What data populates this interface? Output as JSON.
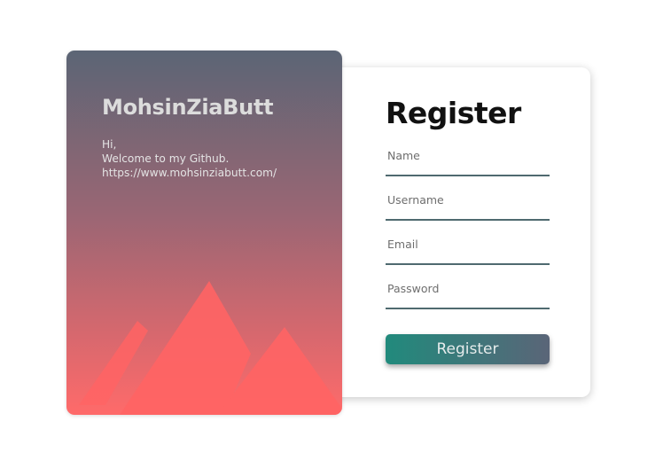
{
  "colors": {
    "page_background": "#ffffff",
    "panel_gradient_top": "#5b6575",
    "panel_gradient_bottom": "#ff6a6a",
    "mountain": "#ff6464",
    "input_underline": "#4f6a70",
    "button_gradient_start": "#218a7c",
    "button_gradient_end": "#5a6578"
  },
  "info_panel": {
    "brand": "MohsinZiaButt",
    "greeting_lines": [
      "Hi,",
      "Welcome to my Github.",
      "https://www.mohsinziabutt.com/"
    ],
    "illustration_icon": "mountains-icon"
  },
  "form": {
    "title": "Register",
    "fields": [
      {
        "name": "name",
        "placeholder": "Name",
        "value": ""
      },
      {
        "name": "username",
        "placeholder": "Username",
        "value": ""
      },
      {
        "name": "email",
        "placeholder": "Email",
        "value": ""
      },
      {
        "name": "password",
        "placeholder": "Password",
        "value": ""
      }
    ],
    "submit_label": "Register"
  }
}
